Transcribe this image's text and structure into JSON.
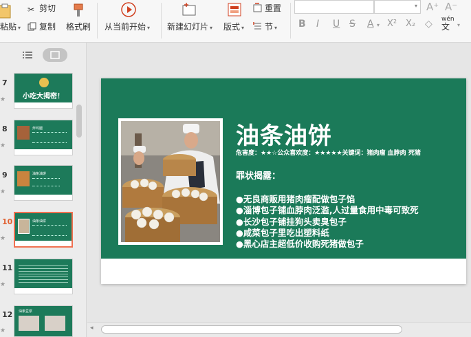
{
  "ribbon": {
    "paste": "粘贴",
    "cut": "剪切",
    "copy": "复制",
    "format_painter": "格式刷",
    "from_current": "从当前开始",
    "new_slide": "新建幻灯片",
    "layout": "版式",
    "reset": "重置",
    "section": "节",
    "font_grow": "A⁺",
    "font_shrink": "A⁻",
    "bold": "B",
    "italic": "I",
    "underline": "U",
    "strike": "S",
    "font_color": "A",
    "superscript": "X²",
    "subscript": "X₂",
    "clear": "◇",
    "pinyin_top": "wén",
    "pinyin_bottom": "文"
  },
  "slides": [
    {
      "num": "7",
      "title": "小吃大揭密！",
      "active": false
    },
    {
      "num": "8",
      "title": "炸鸡腿",
      "active": false
    },
    {
      "num": "9",
      "title": "油条油饼",
      "active": false
    },
    {
      "num": "10",
      "title": "油条油饼",
      "active": true
    },
    {
      "num": "11",
      "title": "",
      "active": false
    },
    {
      "num": "12",
      "title": "油条豆浆",
      "active": false
    }
  ],
  "slide": {
    "title": "油条油饼",
    "subline": "危害度：★★☆公众喜欢度：★★★★★关键词：猪肉瘤 血脖肉   死猪",
    "crime_heading": "罪状揭露：",
    "bullets": [
      "●无良商贩用猪肉瘤配做包子馅",
      "●淄博包子铺血脖肉泛滥,人过量食用中毒可致死",
      "●长沙包子铺挂狗头卖臭包子",
      "●咸菜包子里吃出塑料纸",
      "●黑心店主超低价收购死猪做包子"
    ]
  },
  "colors": {
    "slide_green": "#1b7a59",
    "active_thumb_border": "#f07050"
  }
}
